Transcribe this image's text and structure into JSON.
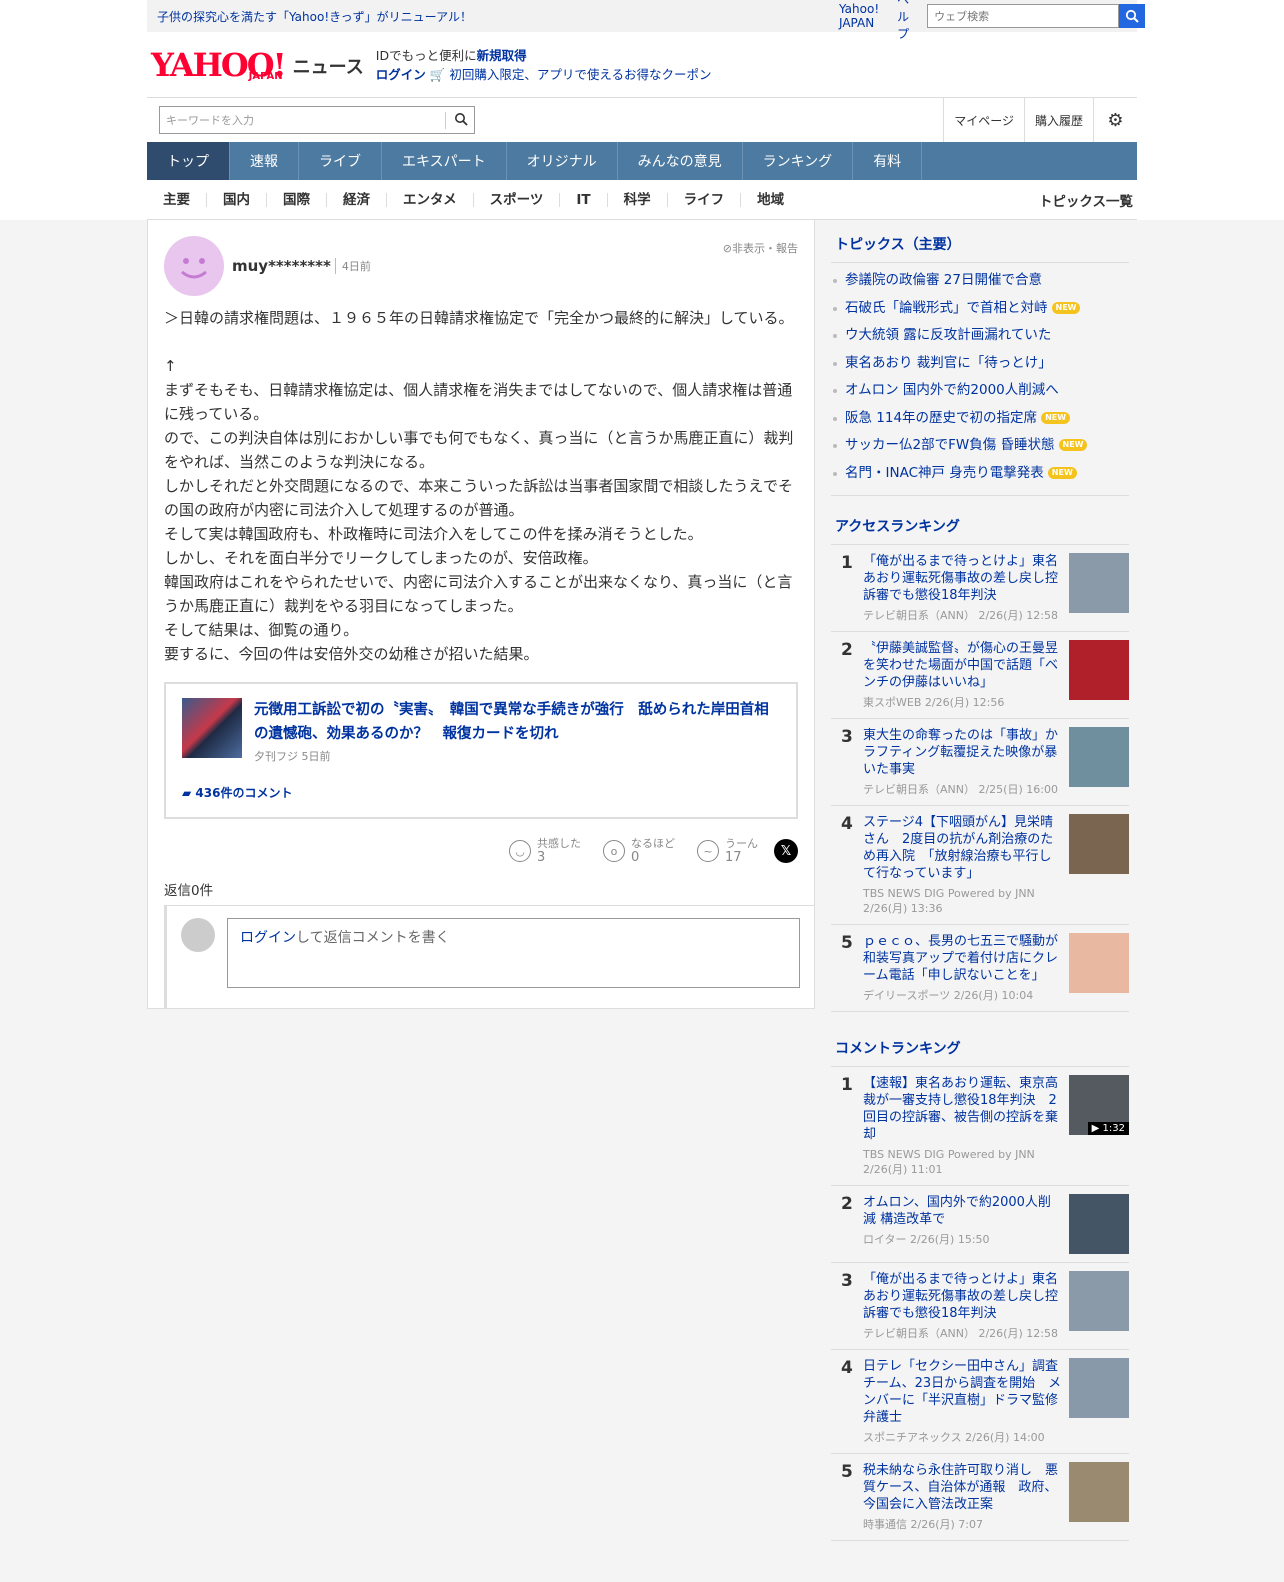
{
  "topbar": {
    "notice": "子供の探究心を満たす「Yahoo!きっず」がリニューアル！",
    "yahoo_japan": "Yahoo! JAPAN",
    "help": "ヘルプ",
    "search_placeholder": "ウェブ検索"
  },
  "header": {
    "logo": "YAHOO!",
    "logo_sub": "JAPAN",
    "news": "ニュース",
    "line1_prefix": "IDでもっと便利に",
    "line1_link": "新規取得",
    "login": "ログイン",
    "coupon": "初回購入限定、アプリで使えるお得なクーポン"
  },
  "search": {
    "placeholder": "キーワードを入力",
    "mypage": "マイページ",
    "history": "購入履歴"
  },
  "nav": [
    "トップ",
    "速報",
    "ライブ",
    "エキスパート",
    "オリジナル",
    "みんなの意見",
    "ランキング",
    "有料"
  ],
  "subnav": {
    "items": [
      "主要",
      "国内",
      "国際",
      "経済",
      "エンタメ",
      "スポーツ",
      "IT",
      "科学",
      "ライフ",
      "地域"
    ],
    "topics_list": "トピックス一覧"
  },
  "comment": {
    "user": "muy********",
    "date": "4日前",
    "report": "非表示・報告",
    "body": "＞日韓の請求権問題は、１９６５年の日韓請求権協定で「完全かつ最終的に解決」している。\n\n↑\nまずそもそも、日韓請求権協定は、個人請求権を消失まではしてないので、個人請求権は普通に残っている。\nので、この判決自体は別におかしい事でも何でもなく、真っ当に（と言うか馬鹿正直に）裁判をやれば、当然このような判決になる。\nしかしそれだと外交問題になるので、本来こういった訴訟は当事者国家間で相談したうえでその国の政府が内密に司法介入して処理するのが普通。\nそして実は韓国政府も、朴政権時に司法介入をしてこの件を揉み消そうとした。\nしかし、それを面白半分でリークしてしまったのが、安倍政権。\n韓国政府はこれをやられたせいで、内密に司法介入することが出来なくなり、真っ当に（と言うか馬鹿正直に）裁判をやる羽目になってしまった。\nそして結果は、御覧の通り。\n要するに、今回の件は安倍外交の幼稚さが招いた結果。",
    "article": {
      "title": "元徴用工訴訟で初の〝実害〟　韓国で異常な手続きが強行　舐められた岸田首相の遺憾砲、効果あるのか？　報復カードを切れ",
      "source": "夕刊フジ 5日前",
      "comments": "436件のコメント"
    },
    "reactions": [
      {
        "label": "共感した",
        "value": "3"
      },
      {
        "label": "なるほど",
        "value": "0"
      },
      {
        "label": "うーん",
        "value": "17"
      }
    ],
    "replies": "返信0件",
    "reply_login": "ログイン",
    "reply_text": "して返信コメントを書く"
  },
  "sidebar": {
    "topics_title": "トピックス（主要）",
    "topics": [
      {
        "text": "参議院の政倫審 27日開催で合意",
        "new": ""
      },
      {
        "text": "石破氏「論戦形式」で首相と対峙",
        "new": "NEW"
      },
      {
        "text": "ウ大統領 露に反攻計画漏れていた",
        "new": ""
      },
      {
        "text": "東名あおり 裁判官に「待っとけ」",
        "new": ""
      },
      {
        "text": "オムロン 国内外で約2000人削減へ",
        "new": ""
      },
      {
        "text": "阪急 114年の歴史で初の指定席",
        "new": "NEW"
      },
      {
        "text": "サッカー仏2部でFW負傷 昏睡状態",
        "new": "NEW"
      },
      {
        "text": "名門・INAC神戸 身売り電撃発表",
        "new": "NEW"
      }
    ],
    "access_title": "アクセスランキング",
    "access": [
      {
        "num": "1",
        "title": "「俺が出るまで待っとけよ」東名あおり運転死傷事故の差し戻し控訴審でも懲役18年判決",
        "meta": "テレビ朝日系（ANN） 2/26(月) 12:58",
        "color": "#8a9aa8"
      },
      {
        "num": "2",
        "title": "〝伊藤美誠監督〟が傷心の王曼昱を笑わせた場面が中国で話題「ベンチの伊藤はいいね」",
        "meta": "東スポWEB 2/26(月) 12:56",
        "color": "#b0202a"
      },
      {
        "num": "3",
        "title": "東大生の命奪ったのは「事故」かラフティング転覆捉えた映像が暴いた事実",
        "meta": "テレビ朝日系（ANN） 2/25(日) 16:00",
        "color": "#6f8f9f"
      },
      {
        "num": "4",
        "title": "ステージ4【下咽頭がん】見栄晴さん　2度目の抗がん剤治療のため再入院　「放射線治療も平行して行なっています」",
        "meta": "TBS NEWS DIG Powered by JNN 2/26(月) 13:36",
        "color": "#7a6650"
      },
      {
        "num": "5",
        "title": "ｐｅｃｏ、長男の七五三で騒動が和装写真アップで着付け店にクレーム電話「申し訳ないことを」",
        "meta": "デイリースポーツ 2/26(月) 10:04",
        "color": "#e8b8a0"
      }
    ],
    "comment_title": "コメントランキング",
    "comment_rank": [
      {
        "num": "1",
        "title": "【速報】東名あおり運転、東京高裁が一審支持し懲役18年判決　2回目の控訴審、被告側の控訴を棄却",
        "meta": "TBS NEWS DIG Powered by JNN 2/26(月) 11:01",
        "color": "#555a60",
        "dur": "▶ 1:32"
      },
      {
        "num": "2",
        "title": "オムロン、国内外で約2000人削減 構造改革で",
        "meta": "ロイター 2/26(月) 15:50",
        "color": "#445566",
        "dur": ""
      },
      {
        "num": "3",
        "title": "「俺が出るまで待っとけよ」東名あおり運転死傷事故の差し戻し控訴審でも懲役18年判決",
        "meta": "テレビ朝日系（ANN） 2/26(月) 12:58",
        "color": "#8a9aa8",
        "dur": ""
      },
      {
        "num": "4",
        "title": "日テレ「セクシー田中さん」調査チーム、23日から調査を開始　メンバーに「半沢直樹」ドラマ監修弁護士",
        "meta": "スポニチアネックス 2/26(月) 14:00",
        "color": "#8899aa",
        "dur": ""
      },
      {
        "num": "5",
        "title": "税未納なら永住許可取り消し　悪質ケース、自治体が通報　政府、今国会に入管法改正案",
        "meta": "時事通信 2/26(月) 7:07",
        "color": "#9a8a70",
        "dur": ""
      }
    ]
  }
}
